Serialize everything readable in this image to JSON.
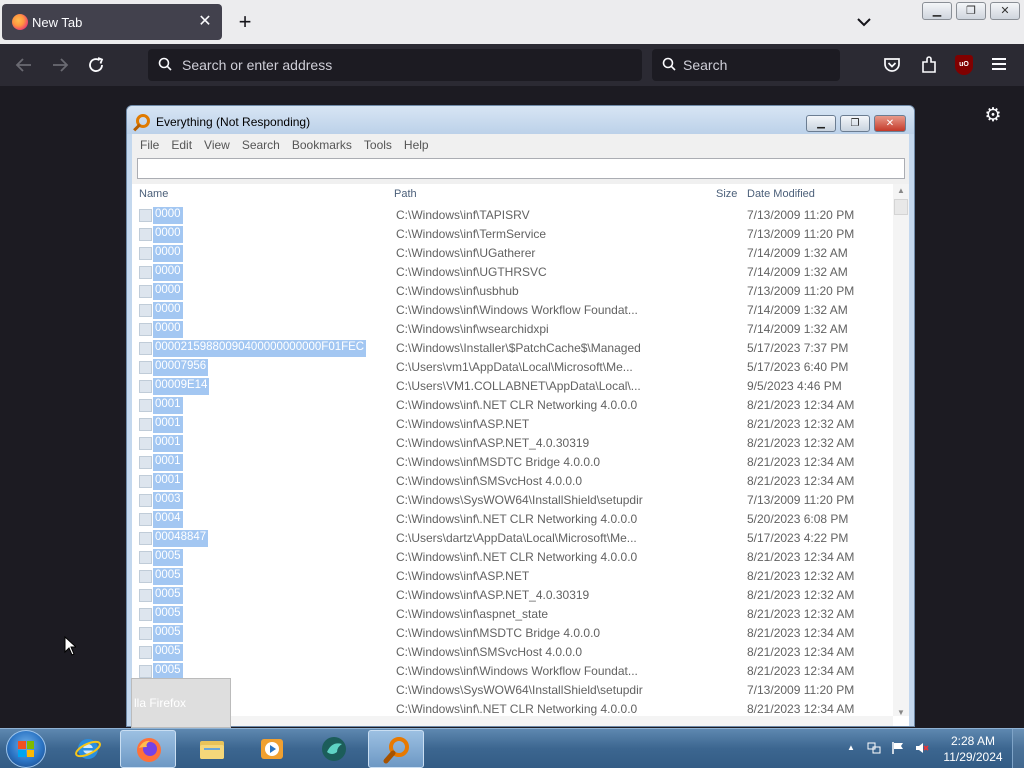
{
  "browser": {
    "tab_title": "New Tab",
    "url_placeholder": "Search or enter address",
    "search_placeholder": "Search"
  },
  "everything": {
    "title": "Everything (Not Responding)",
    "menu": [
      "File",
      "Edit",
      "View",
      "Search",
      "Bookmarks",
      "Tools",
      "Help"
    ],
    "search_value": "",
    "columns": {
      "name": "Name",
      "path": "Path",
      "size": "Size",
      "date": "Date Modified"
    },
    "rows": [
      {
        "name": "0000",
        "path": "C:\\Windows\\inf\\TAPISRV",
        "date": "7/13/2009 11:20 PM"
      },
      {
        "name": "0000",
        "path": "C:\\Windows\\inf\\TermService",
        "date": "7/13/2009 11:20 PM"
      },
      {
        "name": "0000",
        "path": "C:\\Windows\\inf\\UGatherer",
        "date": "7/14/2009 1:32 AM"
      },
      {
        "name": "0000",
        "path": "C:\\Windows\\inf\\UGTHRSVC",
        "date": "7/14/2009 1:32 AM"
      },
      {
        "name": "0000",
        "path": "C:\\Windows\\inf\\usbhub",
        "date": "7/13/2009 11:20 PM"
      },
      {
        "name": "0000",
        "path": "C:\\Windows\\inf\\Windows Workflow Foundat...",
        "date": "7/14/2009 1:32 AM"
      },
      {
        "name": "0000",
        "path": "C:\\Windows\\inf\\wsearchidxpi",
        "date": "7/14/2009 1:32 AM"
      },
      {
        "name": "00002159880090400000000000F01FEC",
        "path": "C:\\Windows\\Installer\\$PatchCache$\\Managed",
        "date": "5/17/2023 7:37 PM"
      },
      {
        "name": "00007956",
        "path": "C:\\Users\\vm1\\AppData\\Local\\Microsoft\\Me...",
        "date": "5/17/2023 6:40 PM"
      },
      {
        "name": "00009E14",
        "path": "C:\\Users\\VM1.COLLABNET\\AppData\\Local\\...",
        "date": "9/5/2023 4:46 PM"
      },
      {
        "name": "0001",
        "path": "C:\\Windows\\inf\\.NET CLR Networking 4.0.0.0",
        "date": "8/21/2023 12:34 AM"
      },
      {
        "name": "0001",
        "path": "C:\\Windows\\inf\\ASP.NET",
        "date": "8/21/2023 12:32 AM"
      },
      {
        "name": "0001",
        "path": "C:\\Windows\\inf\\ASP.NET_4.0.30319",
        "date": "8/21/2023 12:32 AM"
      },
      {
        "name": "0001",
        "path": "C:\\Windows\\inf\\MSDTC Bridge 4.0.0.0",
        "date": "8/21/2023 12:34 AM"
      },
      {
        "name": "0001",
        "path": "C:\\Windows\\inf\\SMSvcHost 4.0.0.0",
        "date": "8/21/2023 12:34 AM"
      },
      {
        "name": "0003",
        "path": "C:\\Windows\\SysWOW64\\InstallShield\\setupdir",
        "date": "7/13/2009 11:20 PM"
      },
      {
        "name": "0004",
        "path": "C:\\Windows\\inf\\.NET CLR Networking 4.0.0.0",
        "date": "5/20/2023 6:08 PM"
      },
      {
        "name": "00048847",
        "path": "C:\\Users\\dartz\\AppData\\Local\\Microsoft\\Me...",
        "date": "5/17/2023 4:22 PM"
      },
      {
        "name": "0005",
        "path": "C:\\Windows\\inf\\.NET CLR Networking 4.0.0.0",
        "date": "8/21/2023 12:34 AM"
      },
      {
        "name": "0005",
        "path": "C:\\Windows\\inf\\ASP.NET",
        "date": "8/21/2023 12:32 AM"
      },
      {
        "name": "0005",
        "path": "C:\\Windows\\inf\\ASP.NET_4.0.30319",
        "date": "8/21/2023 12:32 AM"
      },
      {
        "name": "0005",
        "path": "C:\\Windows\\inf\\aspnet_state",
        "date": "8/21/2023 12:32 AM"
      },
      {
        "name": "0005",
        "path": "C:\\Windows\\inf\\MSDTC Bridge 4.0.0.0",
        "date": "8/21/2023 12:34 AM"
      },
      {
        "name": "0005",
        "path": "C:\\Windows\\inf\\SMSvcHost 4.0.0.0",
        "date": "8/21/2023 12:34 AM"
      },
      {
        "name": "0005",
        "path": "C:\\Windows\\inf\\Windows Workflow Foundat...",
        "date": "8/21/2023 12:34 AM"
      },
      {
        "name": "",
        "path": "C:\\Windows\\SysWOW64\\InstallShield\\setupdir",
        "date": "7/13/2009 11:20 PM"
      },
      {
        "name": "",
        "path": "C:\\Windows\\inf\\.NET CLR Networking 4.0.0.0",
        "date": "8/21/2023 12:34 AM"
      }
    ]
  },
  "taskbar_preview": "lla Firefox",
  "clock": {
    "time": "2:28 AM",
    "date": "11/29/2024"
  },
  "taskbar_apps": [
    "internet-explorer",
    "firefox",
    "file-explorer",
    "media-player",
    "bird-app",
    "everything-search"
  ],
  "colors": {
    "selection": "#a3c7f2",
    "firefox_dark": "#1c1b22",
    "taskbar": "#3c6690"
  }
}
